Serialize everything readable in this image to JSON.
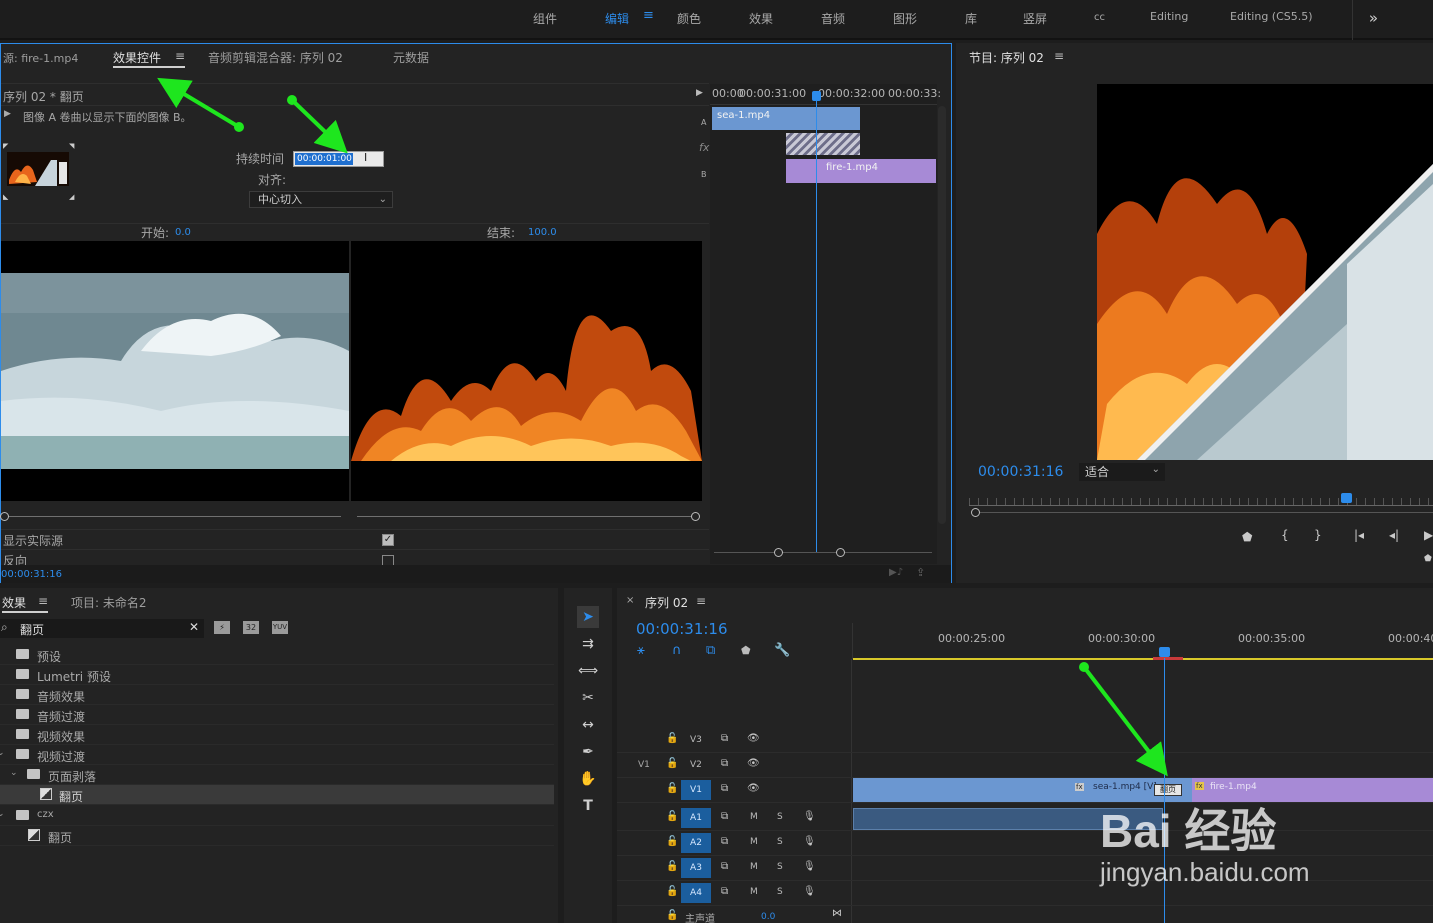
{
  "workspace": {
    "tabs": [
      "组件",
      "编辑",
      "颜色",
      "效果",
      "音频",
      "图形",
      "库",
      "竖屏",
      "cc",
      "Editing",
      "Editing (CS5.5)"
    ],
    "active_tab": "编辑",
    "more": "»"
  },
  "effect_controls": {
    "source_tab": "源: fire-1.mp4",
    "ec_tab": "效果控件",
    "audio_mixer_tab": "音频剪辑混合器: 序列 02",
    "metadata_tab": "元数据",
    "clip_path": "序列 02 * 翻页",
    "description": "图像 A 卷曲以显示下面的图像 B。",
    "duration_label": "持续时间",
    "duration_value": "00:00:01:00",
    "align_label": "对齐:",
    "align_value": "中心切入",
    "start_label": "开始:",
    "start_value": "0.0",
    "end_label": "结束:",
    "end_value": "100.0",
    "show_actual_sources": "显示实际源",
    "reverse": "反向",
    "timecode": "00:00:31:16",
    "mini_ruler": [
      "00:00",
      "00:00:31:00",
      "00:00:32:00",
      "00:00:33:"
    ],
    "track_a": "A",
    "track_b": "B",
    "fx_label": "fx",
    "clip_a": "sea-1.mp4",
    "clip_b": "fire-1.mp4"
  },
  "program": {
    "title": "节目: 序列 02",
    "timecode": "00:00:31:16",
    "fit": "适合"
  },
  "effects_panel": {
    "tab": "效果",
    "project_tab": "项目: 未命名2",
    "search": "翻页",
    "tree": [
      {
        "label": "预设",
        "level": 0
      },
      {
        "label": "Lumetri 预设",
        "level": 0
      },
      {
        "label": "音频效果",
        "level": 0
      },
      {
        "label": "音频过渡",
        "level": 0
      },
      {
        "label": "视频效果",
        "level": 0
      },
      {
        "label": "视频过渡",
        "level": 0
      },
      {
        "label": "页面剥落",
        "level": 1
      },
      {
        "label": "翻页",
        "level": 2
      },
      {
        "label": "czx",
        "level": 0
      },
      {
        "label": "翻页",
        "level": 1
      }
    ]
  },
  "timeline": {
    "title": "序列 02",
    "timecode": "00:00:31:16",
    "ruler": [
      "00:00:25:00",
      "00:00:30:00",
      "00:00:35:00",
      "00:00:40:"
    ],
    "video_tracks": [
      "V3",
      "V2",
      "V1"
    ],
    "audio_tracks": [
      "A1",
      "A2",
      "A3",
      "A4"
    ],
    "source_v1": "V1",
    "mute": "M",
    "solo": "S",
    "master": "主声道",
    "master_value": "0.0",
    "clip_sea": "sea-1.mp4 [V]",
    "clip_fire": "fire-1.mp4",
    "transition": "翻页",
    "fx_badge": "fx"
  },
  "watermark": {
    "line1": "Bai 经验",
    "line2": "jingyan.baidu.com"
  },
  "colors": {
    "accent": "#2d8ceb",
    "clip_blue": "#6b97d1",
    "clip_purple": "#a78ad6",
    "arrow": "#1ee61e"
  }
}
